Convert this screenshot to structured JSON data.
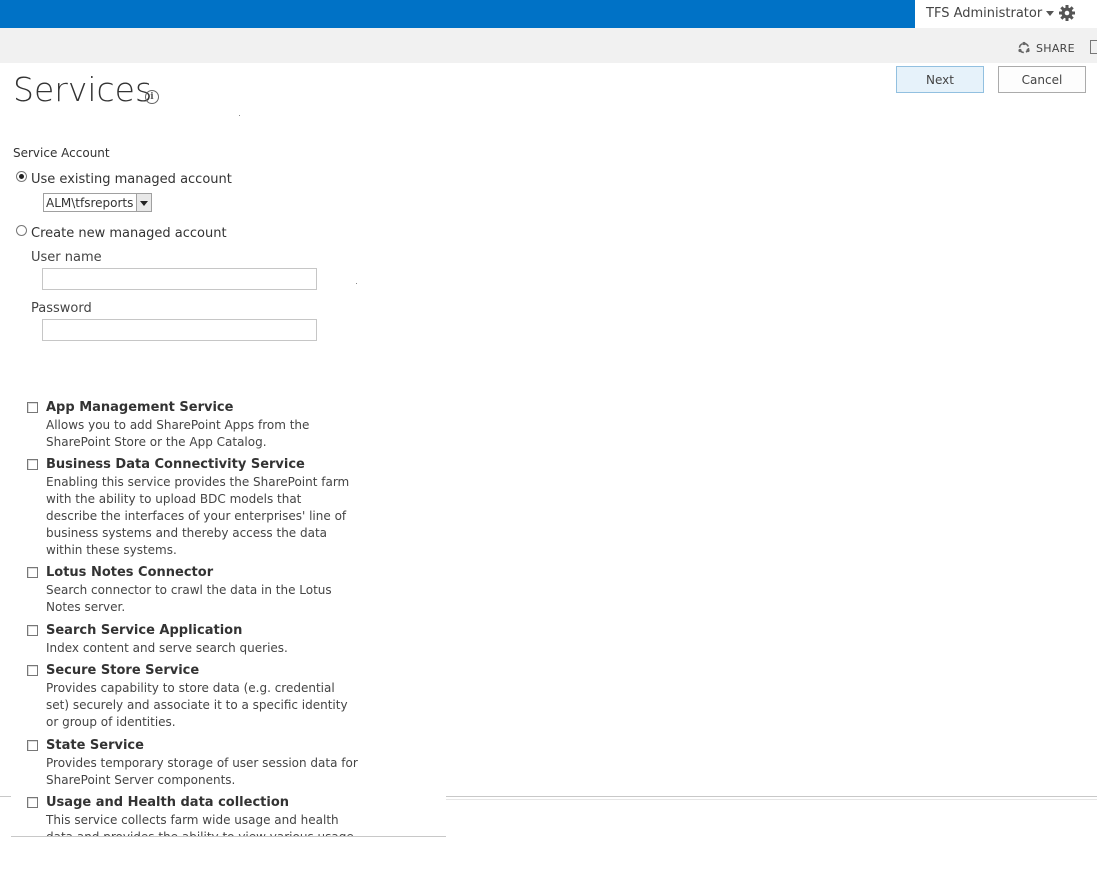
{
  "header": {
    "user_name": "TFS Administrator",
    "share_label": "SHARE",
    "accent_color": "#0072c6"
  },
  "page": {
    "title": "Services",
    "next_label": "Next",
    "cancel_label": "Cancel"
  },
  "service_account": {
    "label": "Service Account",
    "use_existing_label": "Use existing managed account",
    "selected_account": "ALM\\tfsreports",
    "create_new_label": "Create new managed account",
    "username_label": "User name",
    "username_value": "",
    "password_label": "Password",
    "password_value": ""
  },
  "services": [
    {
      "title": "App Management Service",
      "description": "Allows you to add SharePoint Apps from the SharePoint Store or the App Catalog."
    },
    {
      "title": "Business Data Connectivity Service",
      "description": "Enabling this service provides the SharePoint farm with the ability to upload BDC models that describe the interfaces of your enterprises' line of business systems and thereby access the data within these systems."
    },
    {
      "title": "Lotus Notes Connector",
      "description": "Search connector to crawl the data in the Lotus Notes server."
    },
    {
      "title": "Search Service Application",
      "description": "Index content and serve search queries."
    },
    {
      "title": "Secure Store Service",
      "description": "Provides capability to store data (e.g. credential set) securely and associate it to a specific identity or group of identities."
    },
    {
      "title": "State Service",
      "description": "Provides temporary storage of user session data for SharePoint Server components."
    },
    {
      "title": "Usage and Health data collection",
      "description": "This service collects farm wide usage and health data and provides the ability to view various usage and health reports."
    }
  ]
}
